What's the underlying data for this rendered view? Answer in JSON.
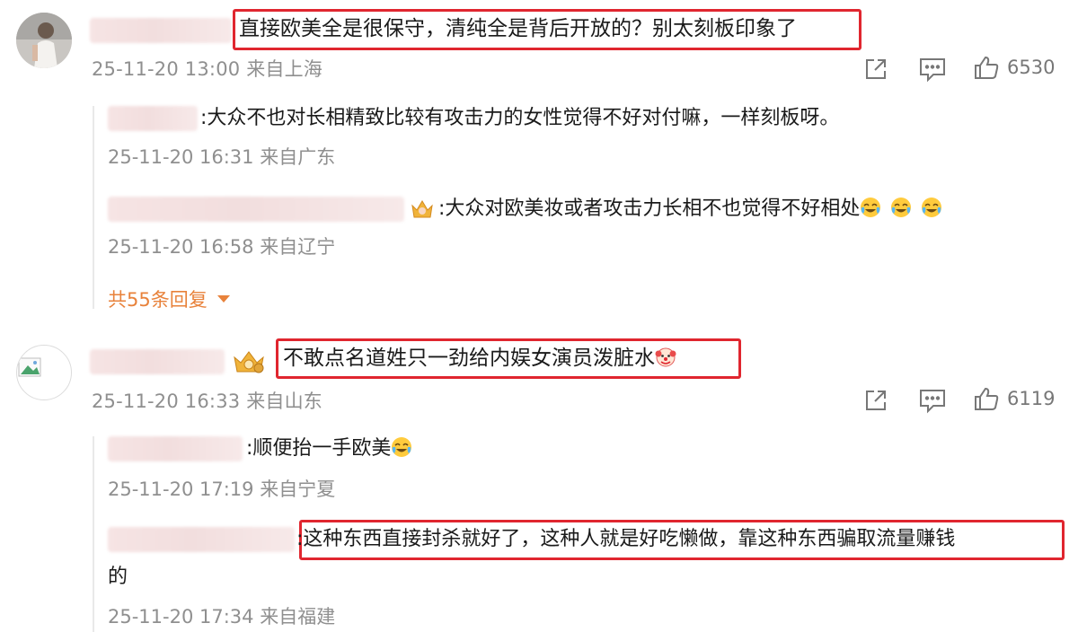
{
  "comments": [
    {
      "text": "直接欧美全是很保守，清纯全是背后开放的？别太刻板印象了",
      "meta": "25-11-20 13:00 来自上海",
      "likes": "6530",
      "replies": [
        {
          "text": ":大众不也对长相精致比较有攻击力的女性觉得不好对付嘛，一样刻板呀。",
          "meta": "25-11-20 16:31 来自广东"
        },
        {
          "text": ":大众对欧美妆或者攻击力长相不也觉得不好相处",
          "meta": "25-11-20 16:58 来自辽宁"
        }
      ],
      "more_replies": "共55条回复"
    },
    {
      "text": "不敢点名道姓只一劲给内娱女演员泼脏水",
      "meta": "25-11-20 16:33 来自山东",
      "likes": "6119",
      "replies": [
        {
          "text": ":顺便抬一手欧美",
          "meta": "25-11-20 17:19 来自宁夏"
        },
        {
          "text": ":这种东西直接封杀就好了，这种人就是好吃懒做，靠这种东西骗取流量赚钱",
          "text_cont": "的",
          "meta": "25-11-20 17:34 来自福建"
        }
      ]
    }
  ],
  "icons": [
    "share-icon",
    "comment-icon",
    "like-icon",
    "crown-icon",
    "laugh-cry-emoji",
    "clown-emoji",
    "chevron-down-icon"
  ],
  "colors": {
    "highlight": "#e0262f",
    "more_link": "#e8823b",
    "meta": "#8f8f8f"
  }
}
